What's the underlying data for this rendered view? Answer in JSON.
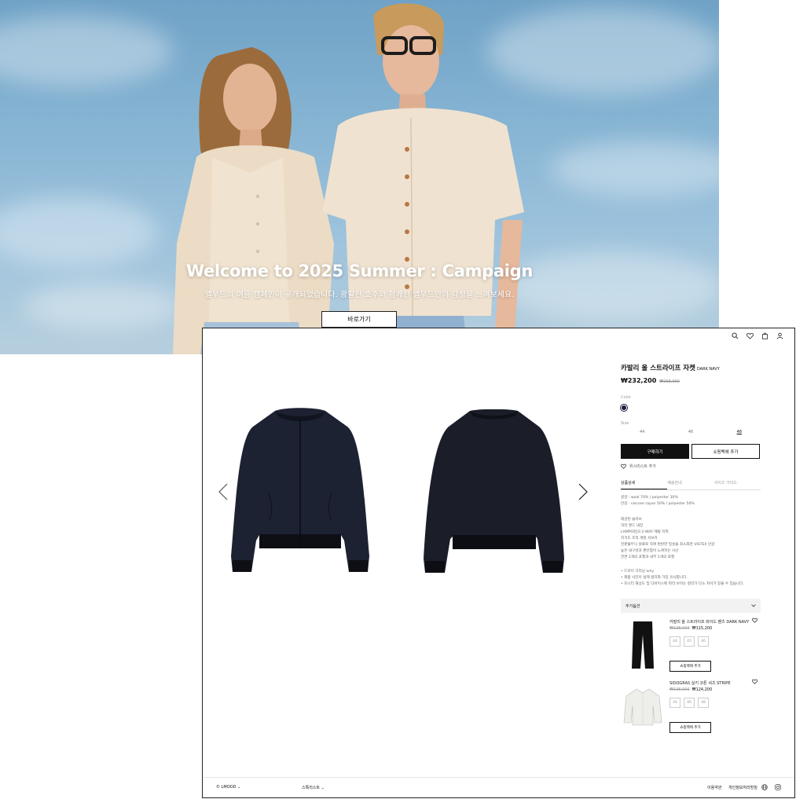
{
  "hero": {
    "title": "Welcome to 2025 Summer : Campaign",
    "subtitle": "엘무드의 여름 캠페인이 공개되었습니다. 광활한 호주와 함께한 엘무드만의 감성을 느껴보세요.",
    "button_label": "바로가기",
    "sky_color": "#86b4d3"
  },
  "header": {
    "icons": [
      "search-icon",
      "heart-icon",
      "bag-icon",
      "user-icon"
    ]
  },
  "product": {
    "name": "카발리 울 스트라이프 자켓",
    "variant": "DARK NAVY",
    "price": "₩232,200",
    "original_price": "₩258,000",
    "color_label": "Color",
    "color_swatch": "#1b2040",
    "size_label": "Size",
    "sizes": [
      "44",
      "46",
      "48"
    ],
    "selected_size": "48",
    "buy_label": "구매하기",
    "cart_label": "쇼핑백에 추가",
    "wishlist_label": "위시리스트 추가",
    "tabs": [
      "상품상세",
      "배송안내",
      "사이즈 가이드"
    ],
    "active_tab": "상품상세",
    "material_lines": [
      "겉감 : wool 70% / polyester 30%",
      "안감 : viscose rayon 50% / polyester 50%"
    ],
    "detail_lines": [
      "레글런 슬리브",
      "허리 밴드 내장",
      "LAMPO社의 2-WAY 메탈 지퍼",
      "지거도 조직 개발 서보카",
      "전판불무늬 원료로 하여 탄탄한 밀성을 최소화한 VISTEX 안감",
      "높은 내구성과 편안함이 느껴지는 사선",
      "전면 2개의 포켓과 내부 1개의 포켓"
    ],
    "notes": [
      "드라이 크리닝 only",
      "제품 사진이 실제 컬러와 가장 유사합니다.",
      "모니터 해상도 및 디바이스에 따라 보이는 컬러가 다소 차이가 있을 수 있습니다."
    ],
    "extra_label": "추가옵션"
  },
  "recommendations": [
    {
      "name": "카발리 울 스트라이프 와이드 팬츠 DARK NAVY",
      "old_price": "₩138,000",
      "price": "₩115,200",
      "sizes": [
        "44",
        "45",
        "46"
      ],
      "button": "쇼핑백에 추가"
    },
    {
      "name": "SIDOGRAS 실키 코튼 셔츠 STRIPE",
      "old_price": "₩138,000",
      "price": "₩124,200",
      "sizes": [
        "44",
        "46",
        "48"
      ],
      "button": "쇼핑백에 추가"
    }
  ],
  "footer": {
    "brand": "© LMOOD",
    "whitelist": "스톡리스트",
    "terms": "이용약관",
    "privacy": "개인정보처리방침"
  }
}
